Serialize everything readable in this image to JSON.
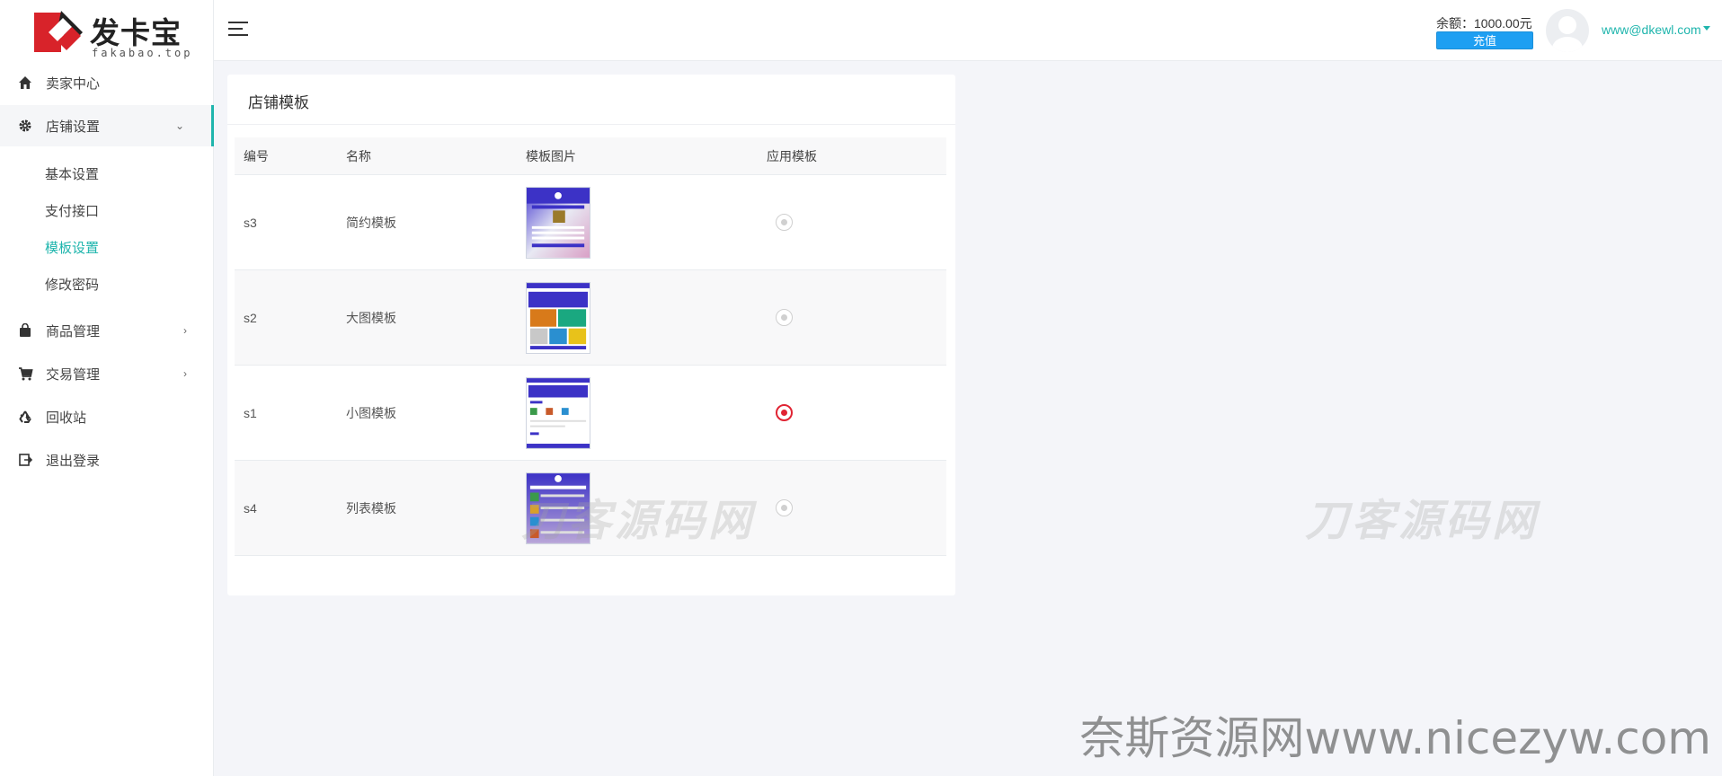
{
  "brand": {
    "name": "发卡宝",
    "domain": "fakabao.top"
  },
  "sidebar": {
    "items": [
      {
        "label": "卖家中心",
        "icon": "home-icon"
      },
      {
        "label": "店铺设置",
        "icon": "gear-icon",
        "expanded": true
      },
      {
        "label": "商品管理",
        "icon": "bag-icon"
      },
      {
        "label": "交易管理",
        "icon": "cart-icon"
      },
      {
        "label": "回收站",
        "icon": "recycle-icon"
      },
      {
        "label": "退出登录",
        "icon": "logout-icon"
      }
    ],
    "subitems": [
      "基本设置",
      "支付接口",
      "模板设置",
      "修改密码"
    ],
    "current_subitem": "模板设置"
  },
  "header": {
    "balance": "余额：1000.00元",
    "recharge_label": "充值",
    "user_email": "www@dkewl.com"
  },
  "panel": {
    "title": "店铺模板",
    "columns": [
      "编号",
      "名称",
      "模板图片",
      "应用模板"
    ],
    "rows": [
      {
        "id": "s3",
        "name": "简约模板",
        "selected": false
      },
      {
        "id": "s2",
        "name": "大图模板",
        "selected": false
      },
      {
        "id": "s1",
        "name": "小图模板",
        "selected": true
      },
      {
        "id": "s4",
        "name": "列表模板",
        "selected": false
      }
    ]
  },
  "watermarks": [
    "刀客源码网",
    "刀客源码网",
    "奈斯资源网www.nicezyw.com"
  ],
  "colors": {
    "accent": "#1fb5ad",
    "primary_button": "#1e9ff2",
    "selected_radio": "#e02433"
  }
}
